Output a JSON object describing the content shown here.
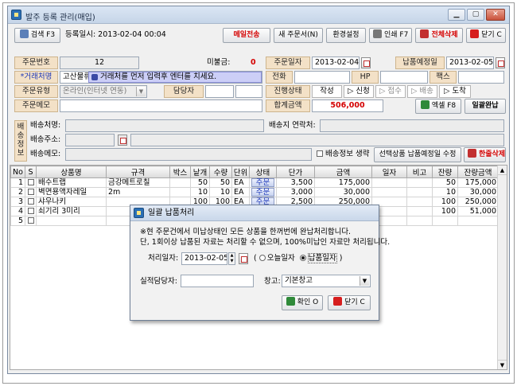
{
  "window": {
    "title": "발주 등록 관리(매입)"
  },
  "toolbar": {
    "search_label": "검색 F3",
    "reg_datetime": "등록일시: 2013-02-04 00:04",
    "mail_send": "메일전송",
    "new_order": "새 주문서(N)",
    "env_settings": "환경설정",
    "print": "인쇄 F7",
    "delete_all": "전체삭제",
    "close": "닫기 C"
  },
  "form": {
    "order_no_label": "주문번호",
    "order_no": "12",
    "unpaid_label": "미불금:",
    "unpaid": "0",
    "order_date_label": "주문일자",
    "order_date": "2013-02-04",
    "due_date_label": "납품예정일",
    "due_date": "2013-02-05",
    "vendor_label": "*거래처명",
    "vendor": "고산물류",
    "vendor_hint": "거래처를 먼저 입력후 엔터를 치세요.",
    "phone_label": "전화",
    "hp_label": "HP",
    "fax_label": "팩스",
    "order_type_label": "주문유형",
    "order_type": "온라인(인터넷 연동)",
    "manager_label": "담당자",
    "status_label": "진행상태",
    "status_steps": [
      "작성",
      "신청",
      "접수",
      "배송",
      "도착"
    ],
    "total_label": "합계금액",
    "total": "506,000",
    "excel": "엑셀 F8",
    "bulk_complete": "일괄완납",
    "memo_label": "주문메모"
  },
  "shipping": {
    "side_label": "배송정보",
    "name_label": "배송처명:",
    "contact_label": "배송지 연락처:",
    "address_label": "배송주소:",
    "memo_label": "배송메모:",
    "omit_label": "배송정보 생략",
    "edit_due": "선택상품 납품예정일 수정",
    "delete_row": "한줄삭제"
  },
  "table": {
    "headers": [
      "No",
      "S",
      "상품명",
      "규격",
      "박스",
      "낱개",
      "수량",
      "단위",
      "상태",
      "단가",
      "금액",
      "일자",
      "비고",
      "잔량",
      "잔량금액"
    ],
    "rows": [
      {
        "no": "1",
        "name": "배수트랩",
        "spec": "금강메트로칠",
        "box": "",
        "each": "50",
        "qty": "50",
        "unit": "EA",
        "status": "주문",
        "price": "3,500",
        "amount": "175,000",
        "date": "",
        "note": "",
        "remain": "50",
        "remain_amt": "175,000"
      },
      {
        "no": "2",
        "name": "벽면용액자레일",
        "spec": "2m",
        "box": "",
        "each": "10",
        "qty": "10",
        "unit": "EA",
        "status": "주문",
        "price": "3,000",
        "amount": "30,000",
        "date": "",
        "note": "",
        "remain": "10",
        "remain_amt": "30,000"
      },
      {
        "no": "3",
        "name": "샤우나키",
        "spec": "",
        "box": "",
        "each": "100",
        "qty": "100",
        "unit": "EA",
        "status": "주문",
        "price": "2,500",
        "amount": "250,000",
        "date": "",
        "note": "",
        "remain": "100",
        "remain_amt": "250,000"
      },
      {
        "no": "4",
        "name": "쇠기리 3미리",
        "spec": "",
        "box": "",
        "each": "",
        "qty": "",
        "unit": "",
        "status": "",
        "price": "",
        "amount": "",
        "date": "",
        "note": "",
        "remain": "100",
        "remain_amt": "51,000"
      },
      {
        "no": "5",
        "name": "",
        "spec": "",
        "box": "",
        "each": "",
        "qty": "",
        "unit": "",
        "status": "",
        "price": "",
        "amount": "",
        "date": "",
        "note": "",
        "remain": "",
        "remain_amt": ""
      }
    ]
  },
  "dialog": {
    "title": "일괄 납품처리",
    "msg1": "※현 주문건에서 미납상태인 모든 상품을 한꺼번에 완납처리합니다.",
    "msg2": "단, 1회이상 납품된 자료는 처리할 수 없으며, 100%미납인 자료만 처리됩니다.",
    "date_label": "처리일자:",
    "date_value": "2013-02-05",
    "opt_today": "오늘일자",
    "opt_due": "납품일자",
    "person_label": "실적담당자:",
    "warehouse_label": "창고:",
    "warehouse_value": "기본창고",
    "ok": "확인 O",
    "close": "닫기 C"
  },
  "colors": {
    "accent_red": "#d40000",
    "label_bg": "#f3e1c7",
    "hint_bg": "#cccff7"
  }
}
